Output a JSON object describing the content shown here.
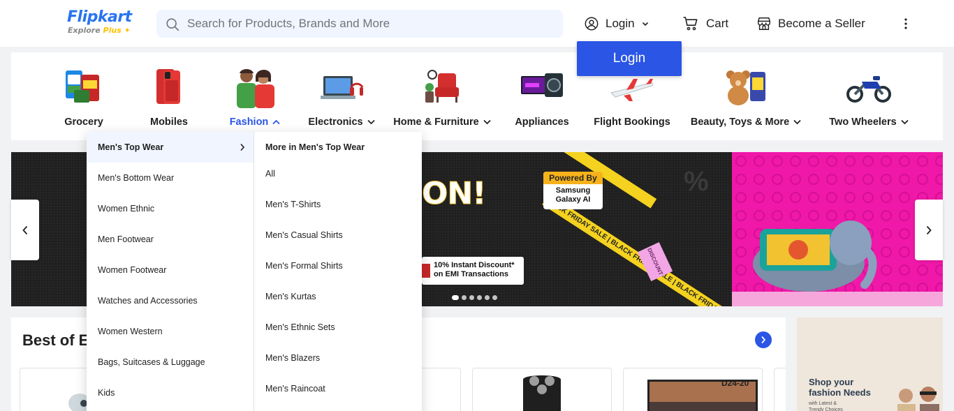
{
  "header": {
    "logo_main": "Flipkart",
    "logo_sub_a": "Explore",
    "logo_sub_b": "Plus",
    "search_placeholder": "Search for Products, Brands and More",
    "login_label": "Login",
    "cart_label": "Cart",
    "seller_label": "Become a Seller",
    "login_popup_label": "Login"
  },
  "categories": [
    {
      "label": "Grocery",
      "has_dropdown": false
    },
    {
      "label": "Mobiles",
      "has_dropdown": false
    },
    {
      "label": "Fashion",
      "has_dropdown": true,
      "active": true
    },
    {
      "label": "Electronics",
      "has_dropdown": true
    },
    {
      "label": "Home & Furniture",
      "has_dropdown": true
    },
    {
      "label": "Appliances",
      "has_dropdown": false
    },
    {
      "label": "Flight Bookings",
      "has_dropdown": false
    },
    {
      "label": "Beauty, Toys & More",
      "has_dropdown": true
    },
    {
      "label": "Two Wheelers",
      "has_dropdown": true
    }
  ],
  "fashion_menu": {
    "items": [
      "Men's Top Wear",
      "Men's Bottom Wear",
      "Women Ethnic",
      "Men Footwear",
      "Women Footwear",
      "Watches and Accessories",
      "Women Western",
      "Bags, Suitcases & Luggage",
      "Kids"
    ],
    "submenu_title": "More in Men's Top Wear",
    "submenu_items": [
      "All",
      "Men's T-Shirts",
      "Men's Casual Shirts",
      "Men's Formal Shirts",
      "Men's Kurtas",
      "Men's Ethnic Sets",
      "Men's Blazers",
      "Men's Raincoat"
    ]
  },
  "banner": {
    "headline_fragment": "ON!",
    "powered_by": "Powered By",
    "powered_brand": "Samsung Galaxy AI",
    "offer_line1": "10% Instant Discount*",
    "offer_line2": "on EMI Transactions",
    "tape_text": "BLACK FRIDAY SALE  |  BLACK FRIDAY SALE  |  BLACK FRIDAY SA",
    "sticker_text": "DISCOUNT",
    "slide_count": 6,
    "active_slide": 1
  },
  "best_section": {
    "title": "Best of E",
    "product_label": "D24-20"
  },
  "ad": {
    "headline": "Shop your fashion Needs",
    "sub": "with Latest & Trendy Choices"
  },
  "colors": {
    "brand_blue": "#2874f0",
    "accent_blue": "#2a55e5",
    "search_bg": "#f0f5ff",
    "banner_pink": "#f018a8"
  }
}
